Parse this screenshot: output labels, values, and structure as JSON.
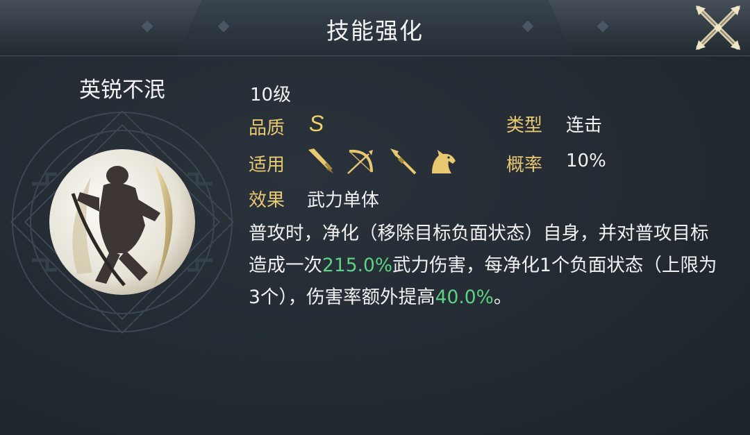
{
  "header": {
    "title": "技能强化",
    "close_icon": "crossed-swords-close-icon"
  },
  "skill": {
    "name": "英锐不泯",
    "level": "10级",
    "quality_label": "品质",
    "quality_value": "S",
    "type_label": "类型",
    "type_value": "连击",
    "applicable_label": "适用",
    "applicable_icons": [
      "sword-icon",
      "bow-icon",
      "spear-icon",
      "horse-icon"
    ],
    "chance_label": "概率",
    "chance_value": "10%",
    "effect_label": "效果",
    "effect_value": "武力单体",
    "description": {
      "part1": "普攻时，净化（移除目标负面状态）自身，并对普攻目标造成一次",
      "value1": "215.0%",
      "part2": "武力伤害，每净化1个负面状态（上限为3个），伤害率额外提高",
      "value2": "40.0%",
      "part3": "。"
    }
  },
  "colors": {
    "label": "#e8c870",
    "highlight": "#5dd184",
    "text": "#f2f2f2",
    "background": "#232a32"
  }
}
